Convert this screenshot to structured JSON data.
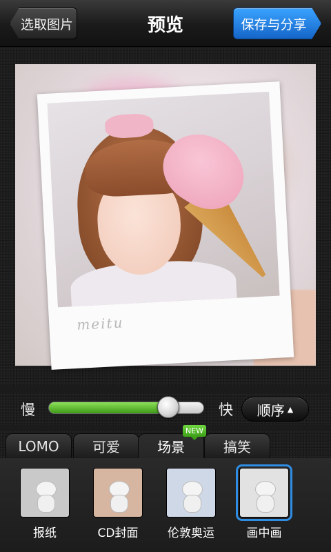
{
  "header": {
    "back_label": "选取图片",
    "title": "预览",
    "save_label": "保存与分享"
  },
  "preview": {
    "watermark": "meitu"
  },
  "speed": {
    "slow_label": "慢",
    "fast_label": "快",
    "value": 0.77,
    "order_label": "顺序"
  },
  "tabs": [
    {
      "label": "LOMO"
    },
    {
      "label": "可爱"
    },
    {
      "label": "场景",
      "active": true
    },
    {
      "label": "搞笑"
    }
  ],
  "new_badge": "NEW",
  "templates": [
    {
      "label": "报纸",
      "thumb_bg": "#c9c9c9"
    },
    {
      "label": "CD封面",
      "thumb_bg": "#d6b5a1"
    },
    {
      "label": "伦敦奥运",
      "thumb_bg": "#cfd8e6"
    },
    {
      "label": "画中画",
      "thumb_bg": "#e2e2e2",
      "selected": true
    }
  ],
  "colors": {
    "accent_blue": "#2f8de4",
    "slider_green": "#5cc02c",
    "badge_green": "#4fb524"
  }
}
